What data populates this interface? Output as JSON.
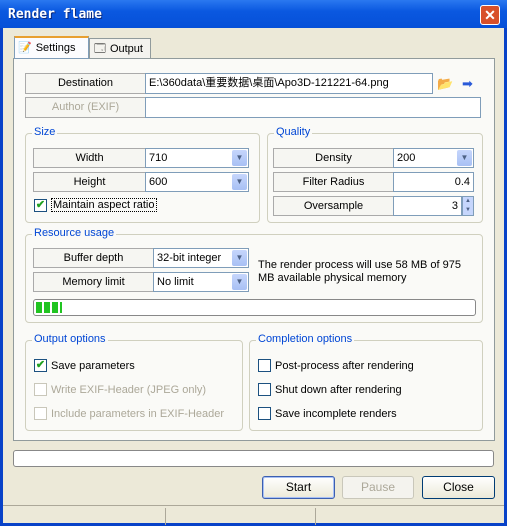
{
  "window": {
    "title": "Render flame"
  },
  "tabs": [
    {
      "label": "Settings"
    },
    {
      "label": "Output"
    }
  ],
  "destination": {
    "label": "Destination",
    "value": "E:\\360data\\重要数据\\桌面\\Apo3D-121221-64.png"
  },
  "author": {
    "label": "Author (EXIF)",
    "value": ""
  },
  "size": {
    "title": "Size",
    "width_label": "Width",
    "width_value": "710",
    "height_label": "Height",
    "height_value": "600",
    "maintain_label": "Maintain aspect ratio",
    "maintain_checked": true
  },
  "quality": {
    "title": "Quality",
    "density_label": "Density",
    "density_value": "200",
    "filter_label": "Filter Radius",
    "filter_value": "0.4",
    "oversample_label": "Oversample",
    "oversample_value": "3"
  },
  "resource": {
    "title": "Resource usage",
    "buffer_label": "Buffer depth",
    "buffer_value": "32-bit integer",
    "memory_label": "Memory limit",
    "memory_value": "No limit",
    "info": "The render process will use 58 MB of 975 MB available physical memory",
    "memory_fraction": 0.06
  },
  "output": {
    "title": "Output options",
    "items": [
      {
        "label": "Save parameters",
        "checked": true,
        "enabled": true
      },
      {
        "label": "Write EXIF-Header (JPEG only)",
        "checked": false,
        "enabled": false
      },
      {
        "label": "Include parameters in EXIF-Header",
        "checked": false,
        "enabled": false
      }
    ]
  },
  "completion": {
    "title": "Completion options",
    "items": [
      {
        "label": "Post-process after rendering",
        "checked": false
      },
      {
        "label": "Shut down after rendering",
        "checked": false
      },
      {
        "label": "Save incomplete renders",
        "checked": false
      }
    ]
  },
  "progress": 0,
  "buttons": {
    "start": "Start",
    "pause": "Pause",
    "close": "Close"
  },
  "colors": {
    "accent": "#0046d5",
    "titlebar": "#0a58e0",
    "progress_fill": "#21c421"
  }
}
